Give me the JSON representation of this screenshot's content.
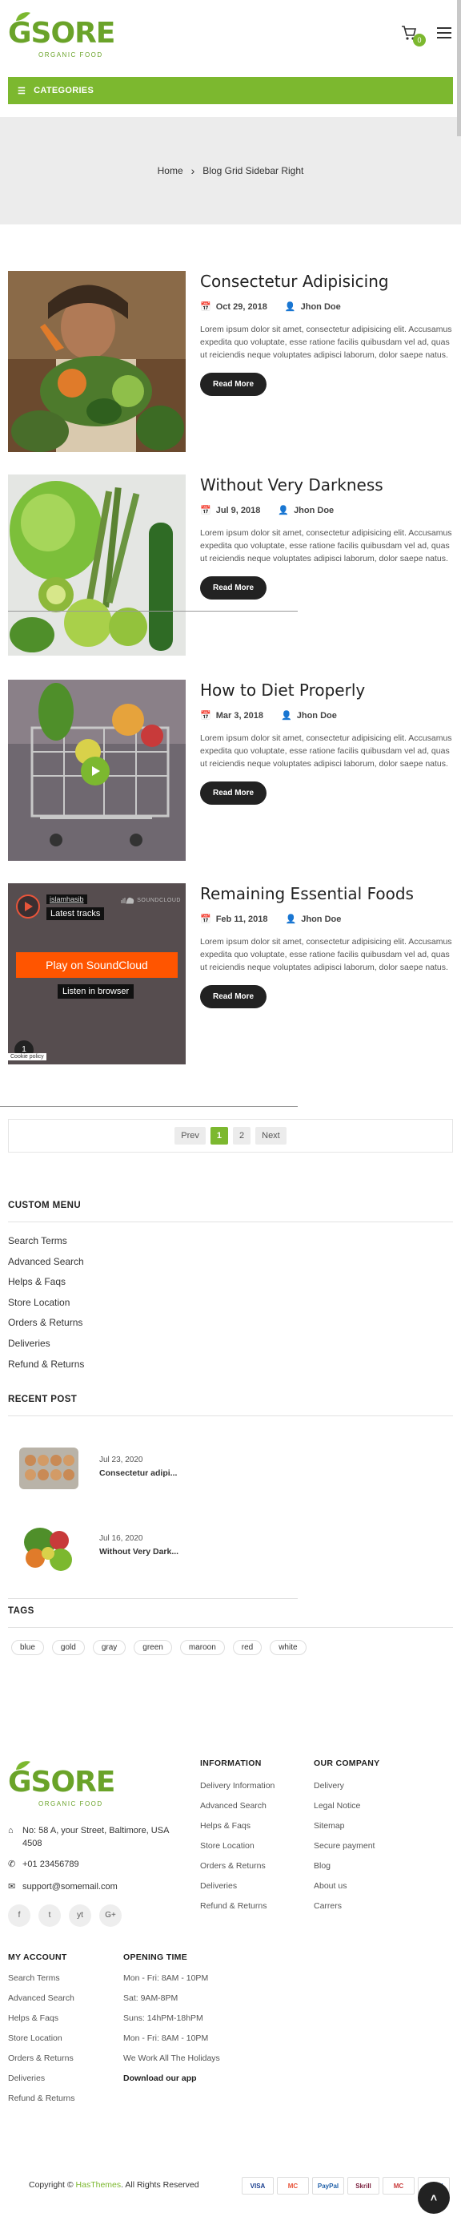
{
  "brand": {
    "logo_main": "GSORE",
    "logo_sub": "ORGANIC FOOD"
  },
  "header": {
    "cart_count": "0",
    "categories_label": "CATEGORIES"
  },
  "breadcrumb": {
    "home": "Home",
    "current": "Blog Grid Sidebar Right"
  },
  "posts": [
    {
      "title": "Consectetur Adipisicing",
      "date": "Oct 29, 2018",
      "author": "Jhon Doe",
      "excerpt": "Lorem ipsum dolor sit amet, consectetur adipisicing elit. Accusamus expedita quo voluptate, esse ratione facilis quibusdam vel ad, quas ut reiciendis neque voluptates adipisci laborum, dolor saepe natus.",
      "button": "Read More"
    },
    {
      "title": "Without Very Darkness",
      "date": "Jul 9, 2018",
      "author": "Jhon Doe",
      "excerpt": "Lorem ipsum dolor sit amet, consectetur adipisicing elit. Accusamus expedita quo voluptate, esse ratione facilis quibusdam vel ad, quas ut reiciendis neque voluptates adipisci laborum, dolor saepe natus.",
      "button": "Read More"
    },
    {
      "title": "How to Diet Properly",
      "date": "Mar 3, 2018",
      "author": "Jhon Doe",
      "excerpt": "Lorem ipsum dolor sit amet, consectetur adipisicing elit. Accusamus expedita quo voluptate, esse ratione facilis quibusdam vel ad, quas ut reiciendis neque voluptates adipisci laborum, dolor saepe natus.",
      "button": "Read More"
    },
    {
      "title": "Remaining Essential Foods",
      "date": "Feb 11, 2018",
      "author": "Jhon Doe",
      "excerpt": "Lorem ipsum dolor sit amet, consectetur adipisicing elit. Accusamus expedita quo voluptate, esse ratione facilis quibusdam vel ad, quas ut reiciendis neque voluptates adipisci laborum, dolor saepe natus.",
      "button": "Read More"
    }
  ],
  "soundcloud": {
    "user": "islamhasib",
    "latest": "Latest tracks",
    "brand": "SOUNDCLOUD",
    "play": "Play on SoundCloud",
    "listen": "Listen in browser",
    "cookie": "Cookie policy",
    "count": "1"
  },
  "pagination": {
    "prev": "Prev",
    "pages": [
      "1",
      "2"
    ],
    "next": "Next"
  },
  "custom_menu": {
    "title": "CUSTOM MENU",
    "items": [
      "Search Terms",
      "Advanced Search",
      "Helps & Faqs",
      "Store Location",
      "Orders & Returns",
      "Deliveries",
      "Refund & Returns"
    ]
  },
  "recent_post": {
    "title": "RECENT POST",
    "items": [
      {
        "date": "Jul 23, 2020",
        "title": "Consectetur adipi..."
      },
      {
        "date": "Jul 16, 2020",
        "title": "Without Very Dark..."
      }
    ]
  },
  "tags": {
    "title": "TAGS",
    "items": [
      "blue",
      "gold",
      "gray",
      "green",
      "maroon",
      "red",
      "white"
    ]
  },
  "footer": {
    "address": "No: 58 A, your Street, Baltimore, USA 4508",
    "phone": "+01 23456789",
    "email": "support@somemail.com",
    "social": [
      "f",
      "t",
      "yt",
      "G+"
    ],
    "information": {
      "title": "INFORMATION",
      "items": [
        "Delivery Information",
        "Advanced Search",
        "Helps & Faqs",
        "Store Location",
        "Orders & Returns",
        "Deliveries",
        "Refund & Returns"
      ]
    },
    "company": {
      "title": "OUR COMPANY",
      "items": [
        "Delivery",
        "Legal Notice",
        "Sitemap",
        "Secure payment",
        "Blog",
        "About us",
        "Carrers"
      ]
    },
    "account": {
      "title": "MY ACCOUNT",
      "items": [
        "Search Terms",
        "Advanced Search",
        "Helps & Faqs",
        "Store Location",
        "Orders & Returns",
        "Deliveries",
        "Refund & Returns"
      ]
    },
    "opening": {
      "title": "OPENING TIME",
      "items": [
        "Mon - Fri: 8AM - 10PM",
        "Sat: 9AM-8PM",
        "Suns: 14hPM-18hPM",
        "Mon - Fri: 8AM - 10PM",
        "We Work All The Holidays"
      ],
      "app": "Download our app"
    },
    "copyright_pre": "Copyright ©",
    "copyright_brand": "HasThemes",
    "copyright_post": ". All Rights Reserved",
    "payments": [
      "VISA",
      "MC",
      "PayPal",
      "Skrill",
      "MC",
      "AMEX"
    ]
  },
  "colors": {
    "accent": "#7cb82f",
    "dark": "#222222"
  }
}
